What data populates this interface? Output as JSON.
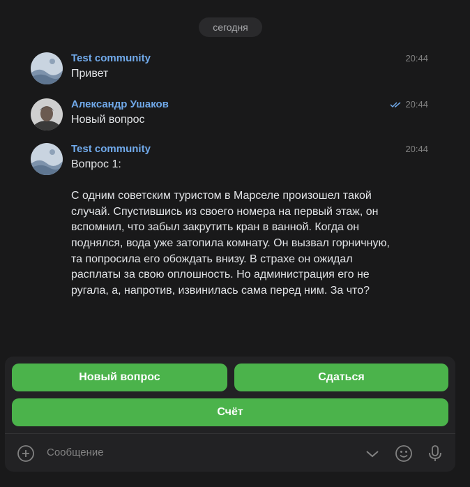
{
  "date_separator": "сегодня",
  "messages": [
    {
      "author": "Test community",
      "time": "20:44",
      "text": "Привет",
      "read": false
    },
    {
      "author": "Александр Ушаков",
      "time": "20:44",
      "text": "Новый вопрос",
      "read": true
    },
    {
      "author": "Test community",
      "time": "20:44",
      "text": "Вопрос 1:\n\nС одним советским туристом в Марселе произошел такой случай. Спустившись из своего номера на первый этаж, он вспомнил, что забыл закрутить кран в ванной. Когда он поднялся, вода уже затопила комнату. Он вызвал горничную, та попросила его обождать внизу. В страхе он ожидал расплаты за свою оплошность. Но администрация его не ругала, а, напротив, извинилась сама перед ним. За что?",
      "read": false
    }
  ],
  "keyboard": {
    "new_question": "Новый вопрос",
    "give_up": "Сдаться",
    "score": "Счёт"
  },
  "composer": {
    "placeholder": "Сообщение"
  },
  "colors": {
    "accent": "#71aaeb",
    "button": "#4bb34b",
    "background": "#19191a"
  },
  "icons": [
    "community-avatar-icon",
    "user-avatar-photo",
    "read-checks-icon",
    "add-attachment-icon",
    "collapse-keyboard-icon",
    "emoji-icon",
    "microphone-icon"
  ]
}
